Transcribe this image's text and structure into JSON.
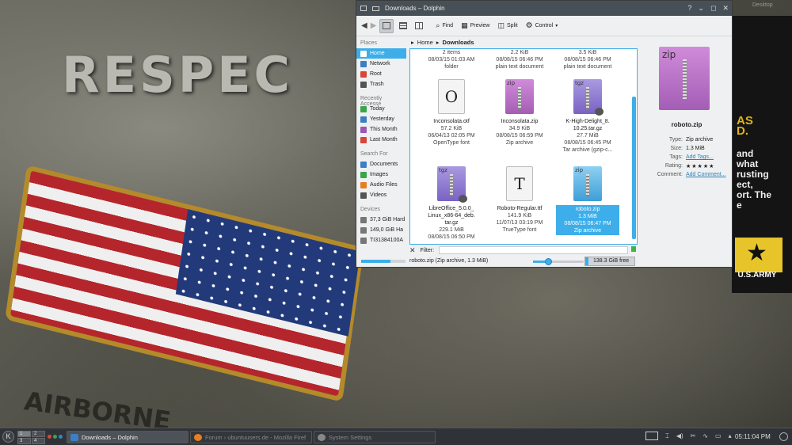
{
  "desktop": {
    "wallpaper_text": "RESPEC",
    "patch_text": "AIRBORNE",
    "poster_lines_yellow": [
      "AS",
      "D."
    ],
    "poster_lines_white": [
      "and",
      "what",
      "rusting",
      "ect,",
      "ort. The",
      "e"
    ],
    "poster_brand": "U.S.ARMY",
    "corner_hint": "Desktop"
  },
  "window": {
    "title": "Downloads – Dolphin"
  },
  "toolbar": {
    "find": "Find",
    "preview": "Preview",
    "split": "Split",
    "control": "Control"
  },
  "places": {
    "places_header": "Places",
    "places": [
      "Home",
      "Network",
      "Root",
      "Trash"
    ],
    "recent_header": "Recently Accesse",
    "recent": [
      "Today",
      "Yesterday",
      "This Month",
      "Last Month"
    ],
    "search_header": "Search For",
    "search": [
      "Documents",
      "Images",
      "Audio Files",
      "Videos"
    ],
    "devices_header": "Devices",
    "devices": [
      "37,3 GiB Hard",
      "149,0 GiB Ha",
      "TI31384100A"
    ]
  },
  "breadcrumb": {
    "home": "Home",
    "current": "Downloads"
  },
  "files": [
    {
      "name": "",
      "line1": "2 items",
      "line2": "08/03/15 01:03 AM",
      "line3": "folder"
    },
    {
      "name": "",
      "line1": "2.2 KiB",
      "line2": "08/08/15 06:46 PM",
      "line3": "plain text document"
    },
    {
      "name": "",
      "line1": "3.5 KiB",
      "line2": "08/08/15 06:46 PM",
      "line3": "plain text document"
    },
    {
      "name": "Inconsolata.otf",
      "line1": "57.2 KiB",
      "line2": "06/04/13 02:05 PM",
      "line3": "OpenType font",
      "icon": "O"
    },
    {
      "name": "Inconsolata.zip",
      "line1": "34.9 KiB",
      "line2": "08/08/15 06:59 PM",
      "line3": "Zip archive",
      "icon": "zip"
    },
    {
      "name": "K-High-Delight_8.\n10.25.tar.gz",
      "line1": "27.7 MiB",
      "line2": "08/08/15 06:45 PM",
      "line3": "Tar archive (gzip-c...",
      "icon": "tgz"
    },
    {
      "name": "LibreOffice_5.0.0_\nLinux_x86-64_deb.\ntar.gz",
      "line1": "229.1 MiB",
      "line2": "08/08/15 06:50 PM",
      "line3": "",
      "icon": "tgz"
    },
    {
      "name": "Roboto-Regular.ttf",
      "line1": "141.9 KiB",
      "line2": "11/07/13 03:19 PM",
      "line3": "TrueType font",
      "icon": "T"
    },
    {
      "name": "roboto.zip",
      "line1": "1.3 MiB",
      "line2": "08/08/15 06:47 PM",
      "line3": "Zip archive",
      "icon": "zip"
    }
  ],
  "filter": {
    "label": "Filter:"
  },
  "status": {
    "text": "roboto.zip (Zip archive, 1.3 MiB)",
    "free": "138.3 GiB free",
    "disk_used_fraction": 0.06,
    "zoom_fraction": 0.3
  },
  "info": {
    "filename": "roboto.zip",
    "icon_label": "zip",
    "type_label": "Type:",
    "type_value": "Zip archive",
    "size_label": "Size:",
    "size_value": "1.3 MiB",
    "tags_label": "Tags:",
    "tags_value": "Add Tags...",
    "rating_label": "Rating:",
    "rating_value": "★★★★★",
    "comment_label": "Comment:",
    "comment_value": "Add Comment..."
  },
  "taskbar": {
    "k_icon": "K",
    "pager": [
      "1",
      "2",
      "3",
      "4"
    ],
    "tasks": [
      "Downloads – Dolphin",
      "Forum › ubuntuusers.de - Mozilla Firef",
      "System Settings"
    ],
    "clock": "05:11:04 PM"
  },
  "colors": {
    "accent": "#3daee9",
    "titlebar": "#475057",
    "taskbar": "#2f3337"
  }
}
